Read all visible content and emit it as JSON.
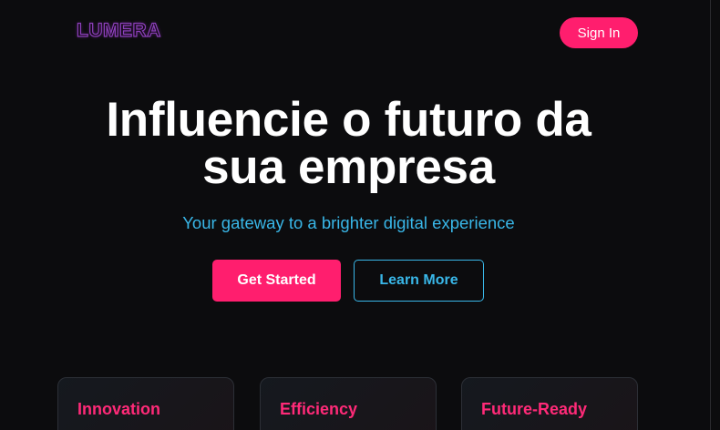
{
  "nav": {
    "logo": "LUMERA",
    "sign_in_label": "Sign In"
  },
  "hero": {
    "title_line1": "Influencie o futuro da",
    "title_line2": "sua empresa",
    "subtitle": "Your gateway to a brighter digital experience",
    "primary_cta": "Get Started",
    "secondary_cta": "Learn More"
  },
  "features": [
    {
      "title": "Innovation"
    },
    {
      "title": "Efficiency"
    },
    {
      "title": "Future-Ready"
    }
  ],
  "colors": {
    "background": "#0c0c0e",
    "accent_pink": "#ff1e6e",
    "accent_cyan": "#39b7e8",
    "logo_outline": "#8a3fb8",
    "text_white": "#ffffff"
  }
}
